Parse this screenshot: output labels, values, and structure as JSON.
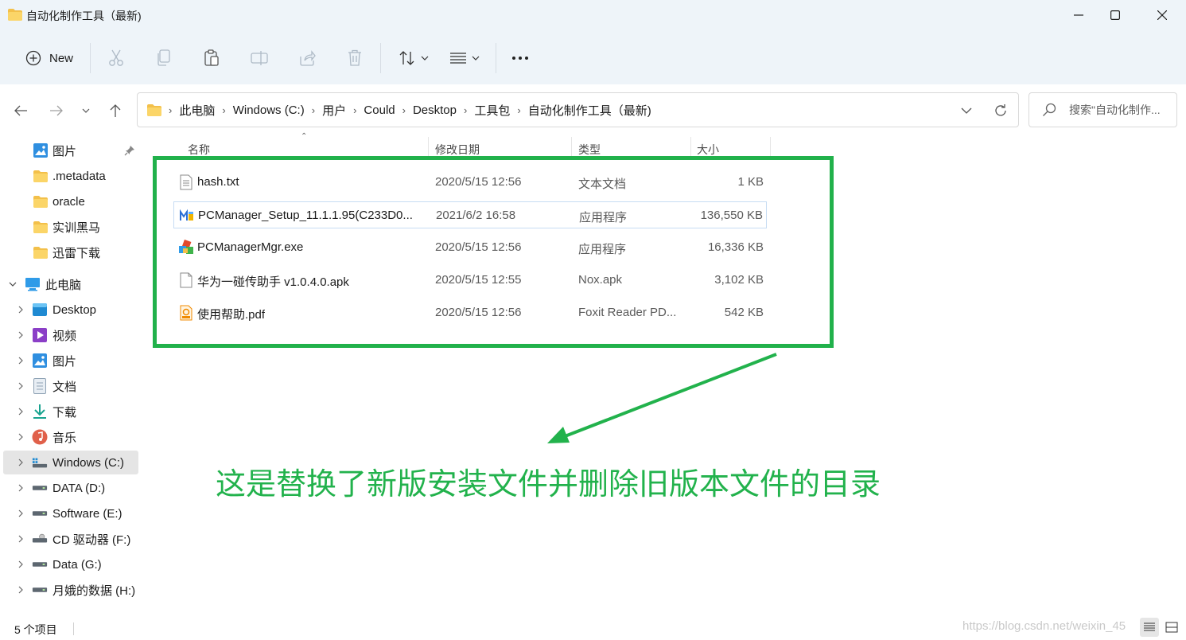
{
  "window": {
    "title": "自动化制作工具（最新)"
  },
  "toolbar": {
    "new_label": "New"
  },
  "address": {
    "crumbs": [
      "此电脑",
      "Windows (C:)",
      "用户",
      "Could",
      "Desktop",
      "工具包",
      "自动化制作工具（最新)"
    ]
  },
  "search": {
    "placeholder": "搜索\"自动化制作..."
  },
  "sidebar": {
    "items": [
      {
        "label": "图片",
        "icon": "pictures-icon"
      },
      {
        "label": ".metadata",
        "icon": "folder-icon"
      },
      {
        "label": "oracle",
        "icon": "folder-icon"
      },
      {
        "label": "实训黑马",
        "icon": "folder-icon"
      },
      {
        "label": "迅雷下载",
        "icon": "folder-icon"
      },
      {
        "label": "此电脑",
        "icon": "pc-icon"
      },
      {
        "label": "Desktop",
        "icon": "desktop-icon"
      },
      {
        "label": "视频",
        "icon": "videos-icon"
      },
      {
        "label": "图片",
        "icon": "pictures-icon"
      },
      {
        "label": "文档",
        "icon": "documents-icon"
      },
      {
        "label": "下载",
        "icon": "downloads-icon"
      },
      {
        "label": "音乐",
        "icon": "music-icon"
      },
      {
        "label": "Windows (C:)",
        "icon": "windows-drive-icon"
      },
      {
        "label": "DATA (D:)",
        "icon": "drive-icon"
      },
      {
        "label": "Software (E:)",
        "icon": "drive-icon"
      },
      {
        "label": "CD 驱动器 (F:)",
        "icon": "cd-drive-icon"
      },
      {
        "label": "Data (G:)",
        "icon": "drive-icon"
      },
      {
        "label": "月娥的数据 (H:)",
        "icon": "drive-icon"
      }
    ]
  },
  "columns": {
    "name": "名称",
    "date": "修改日期",
    "type": "类型",
    "size": "大小"
  },
  "files": [
    {
      "name": "hash.txt",
      "date": "2020/5/15 12:56",
      "type": "文本文档",
      "size": "1 KB",
      "icon": "text-file-icon"
    },
    {
      "name": "PCManager_Setup_11.1.1.95(C233D0...",
      "date": "2021/6/2 16:58",
      "type": "应用程序",
      "size": "136,550 KB",
      "icon": "pcmanager-setup-icon"
    },
    {
      "name": "PCManagerMgr.exe",
      "date": "2020/5/15 12:56",
      "type": "应用程序",
      "size": "16,336 KB",
      "icon": "exe-icon"
    },
    {
      "name": "华为一碰传助手 v1.0.4.0.apk",
      "date": "2020/5/15 12:55",
      "type": "Nox.apk",
      "size": "3,102 KB",
      "icon": "blank-file-icon"
    },
    {
      "name": "使用帮助.pdf",
      "date": "2020/5/15 12:56",
      "type": "Foxit Reader PD...",
      "size": "542 KB",
      "icon": "pdf-file-icon"
    }
  ],
  "annotation": {
    "text": "这是替换了新版安装文件并删除旧版本文件的目录",
    "color": "#22b24c"
  },
  "status": {
    "count": "5 个项目"
  },
  "watermark": "https://blog.csdn.net/weixin_45"
}
